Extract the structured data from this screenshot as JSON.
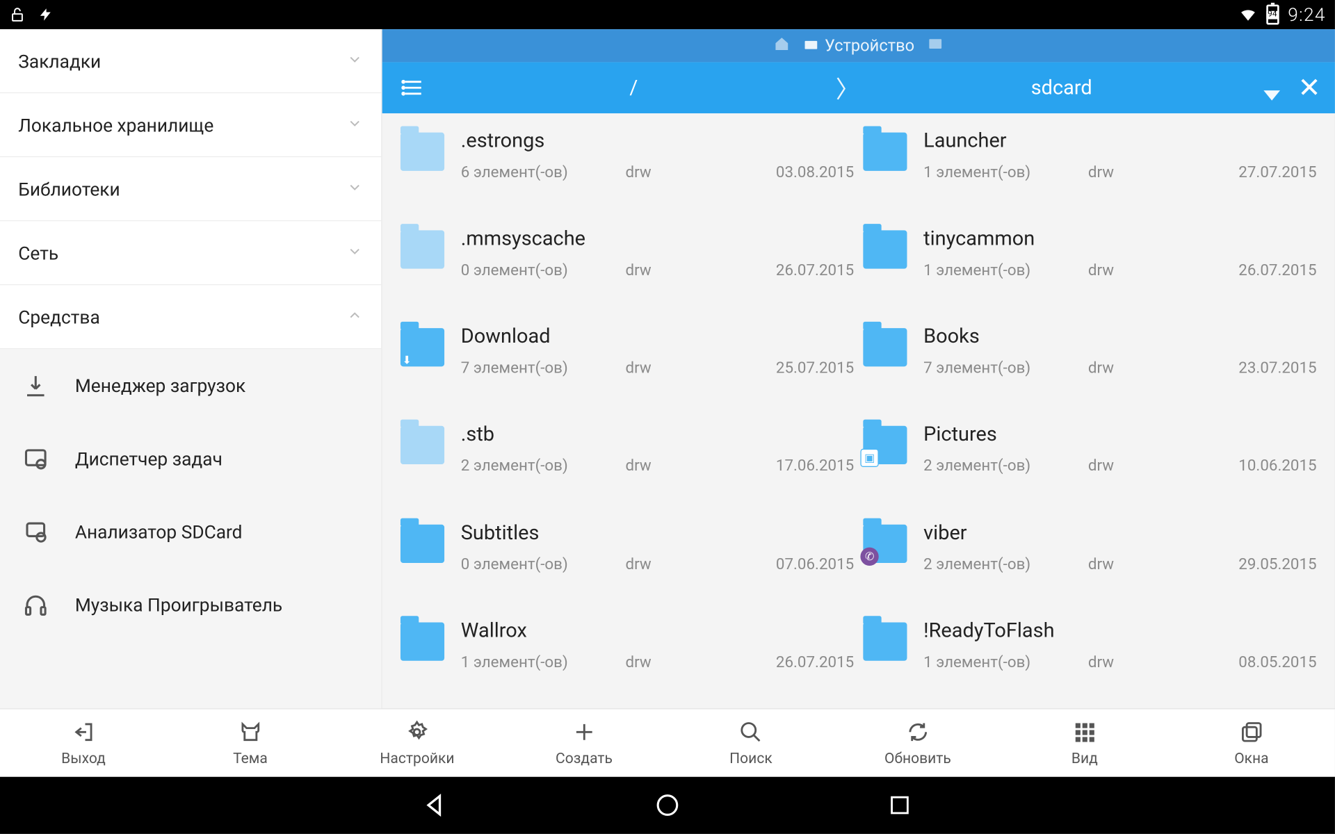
{
  "status": {
    "battery": "94",
    "time": "9:24"
  },
  "sidebar": {
    "items": [
      {
        "label": "Закладки"
      },
      {
        "label": "Локальное хранилище"
      },
      {
        "label": "Библиотеки"
      },
      {
        "label": "Сеть"
      },
      {
        "label": "Средства"
      }
    ],
    "tools": [
      {
        "label": "Менеджер загрузок"
      },
      {
        "label": "Диспетчер задач"
      },
      {
        "label": "Анализатор SDCard"
      },
      {
        "label": "Музыка Проигрыватель"
      }
    ]
  },
  "tab": {
    "label": "Устройство"
  },
  "path": {
    "root": "/",
    "current": "sdcard"
  },
  "folders_left": [
    {
      "name": ".estrongs",
      "count": "6 элемент(-ов)",
      "perm": "drw",
      "date": "03.08.2015",
      "light": true
    },
    {
      "name": ".mmsyscache",
      "count": "0 элемент(-ов)",
      "perm": "drw",
      "date": "26.07.2015",
      "light": true
    },
    {
      "name": "Download",
      "count": "7 элемент(-ов)",
      "perm": "drw",
      "date": "25.07.2015",
      "light": false,
      "dl": true
    },
    {
      "name": ".stb",
      "count": "2 элемент(-ов)",
      "perm": "drw",
      "date": "17.06.2015",
      "light": true
    },
    {
      "name": "Subtitles",
      "count": "0 элемент(-ов)",
      "perm": "drw",
      "date": "07.06.2015",
      "light": false
    },
    {
      "name": "Wallrox",
      "count": "1 элемент(-ов)",
      "perm": "drw",
      "date": "26.07.2015",
      "light": false
    }
  ],
  "folders_right": [
    {
      "name": "Launcher",
      "count": "1 элемент(-ов)",
      "perm": "drw",
      "date": "27.07.2015",
      "light": false
    },
    {
      "name": "tinycammon",
      "count": "1 элемент(-ов)",
      "perm": "drw",
      "date": "26.07.2015",
      "light": false
    },
    {
      "name": "Books",
      "count": "7 элемент(-ов)",
      "perm": "drw",
      "date": "23.07.2015",
      "light": false
    },
    {
      "name": "Pictures",
      "count": "2 элемент(-ов)",
      "perm": "drw",
      "date": "10.06.2015",
      "light": false,
      "pic": true
    },
    {
      "name": "viber",
      "count": "2 элемент(-ов)",
      "perm": "drw",
      "date": "29.05.2015",
      "light": false,
      "viber": true
    },
    {
      "name": "!ReadyToFlash",
      "count": "1 элемент(-ов)",
      "perm": "drw",
      "date": "08.05.2015",
      "light": false
    }
  ],
  "toolbar": [
    {
      "label": "Выход"
    },
    {
      "label": "Тема"
    },
    {
      "label": "Настройки"
    },
    {
      "label": "Создать"
    },
    {
      "label": "Поиск"
    },
    {
      "label": "Обновить"
    },
    {
      "label": "Вид"
    },
    {
      "label": "Окна"
    }
  ]
}
